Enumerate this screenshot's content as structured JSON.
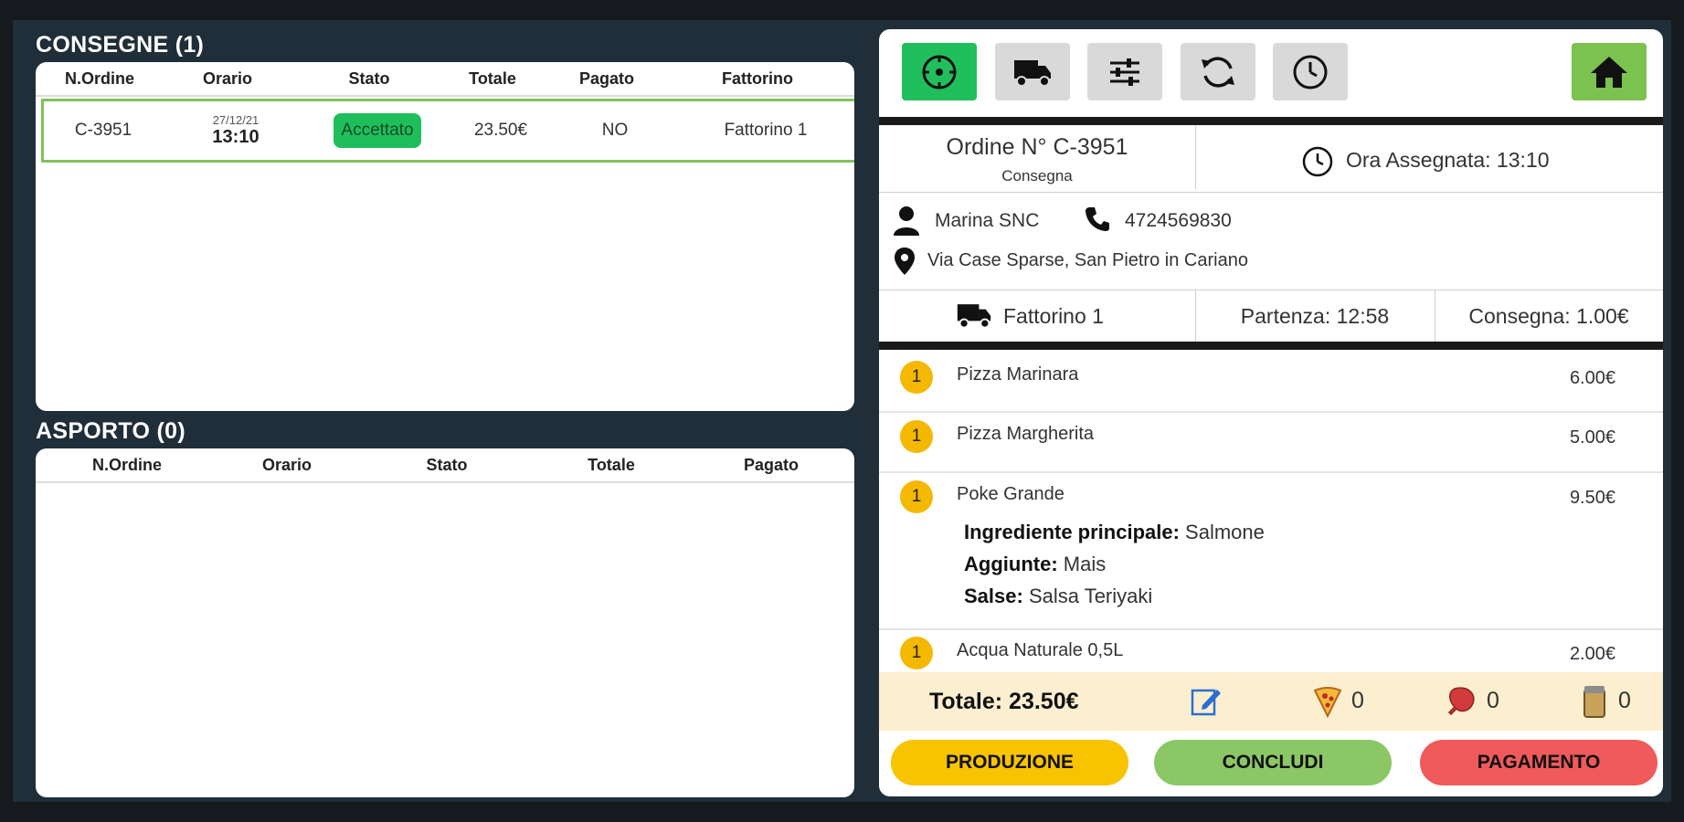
{
  "consegne": {
    "title": "CONSEGNE (1)",
    "columns": [
      "N.Ordine",
      "Orario",
      "Stato",
      "Totale",
      "Pagato",
      "Fattorino"
    ],
    "rows": [
      {
        "order": "C-3951",
        "date": "27/12/21",
        "time": "13:10",
        "status": "Accettato",
        "total": "23.50€",
        "paid": "NO",
        "rider": "Fattorino 1"
      }
    ]
  },
  "asporto": {
    "title": "ASPORTO (0)",
    "columns": [
      "N.Ordine",
      "Orario",
      "Stato",
      "Totale",
      "Pagato"
    ]
  },
  "toolbar": {
    "buttons": [
      "add-circle-icon",
      "truck-icon",
      "sliders-icon",
      "refresh-icon",
      "clock-icon",
      "home-icon"
    ]
  },
  "order": {
    "number": "Ordine N° C-3951",
    "type": "Consegna",
    "assigned_time": "Ora Assegnata: 13:10",
    "customer": "Marina SNC",
    "phone": "4724569830",
    "address": "Via Case Sparse, San Pietro in Cariano",
    "rider": "Fattorino 1",
    "departure": "Partenza: 12:58",
    "delivery_fee": "Consegna: 1.00€"
  },
  "items": [
    {
      "qty": "1",
      "name": "Pizza Marinara",
      "price": "6.00€"
    },
    {
      "qty": "1",
      "name": "Pizza Margherita",
      "price": "5.00€"
    },
    {
      "qty": "1",
      "name": "Poke Grande",
      "price": "9.50€",
      "details": [
        {
          "label": "Ingrediente principale:",
          "value": " Salmone"
        },
        {
          "label": "Aggiunte:",
          "value": " Mais"
        },
        {
          "label": "Salse:",
          "value": " Salsa Teriyaki"
        }
      ]
    },
    {
      "qty": "1",
      "name": "Acqua Naturale 0,5L",
      "price": "2.00€"
    }
  ],
  "footer": {
    "total": "Totale: 23.50€",
    "pizza_count": "0",
    "meat_count": "0",
    "drink_count": "0"
  },
  "actions": {
    "produzione": "PRODUZIONE",
    "concludi": "CONCLUDI",
    "pagamento": "PAGAMENTO"
  },
  "colors": {
    "accent_green": "#21bf5b",
    "home_green": "#7cc24e",
    "badge_yellow": "#f5b800",
    "pill_red": "#f15a5a"
  }
}
